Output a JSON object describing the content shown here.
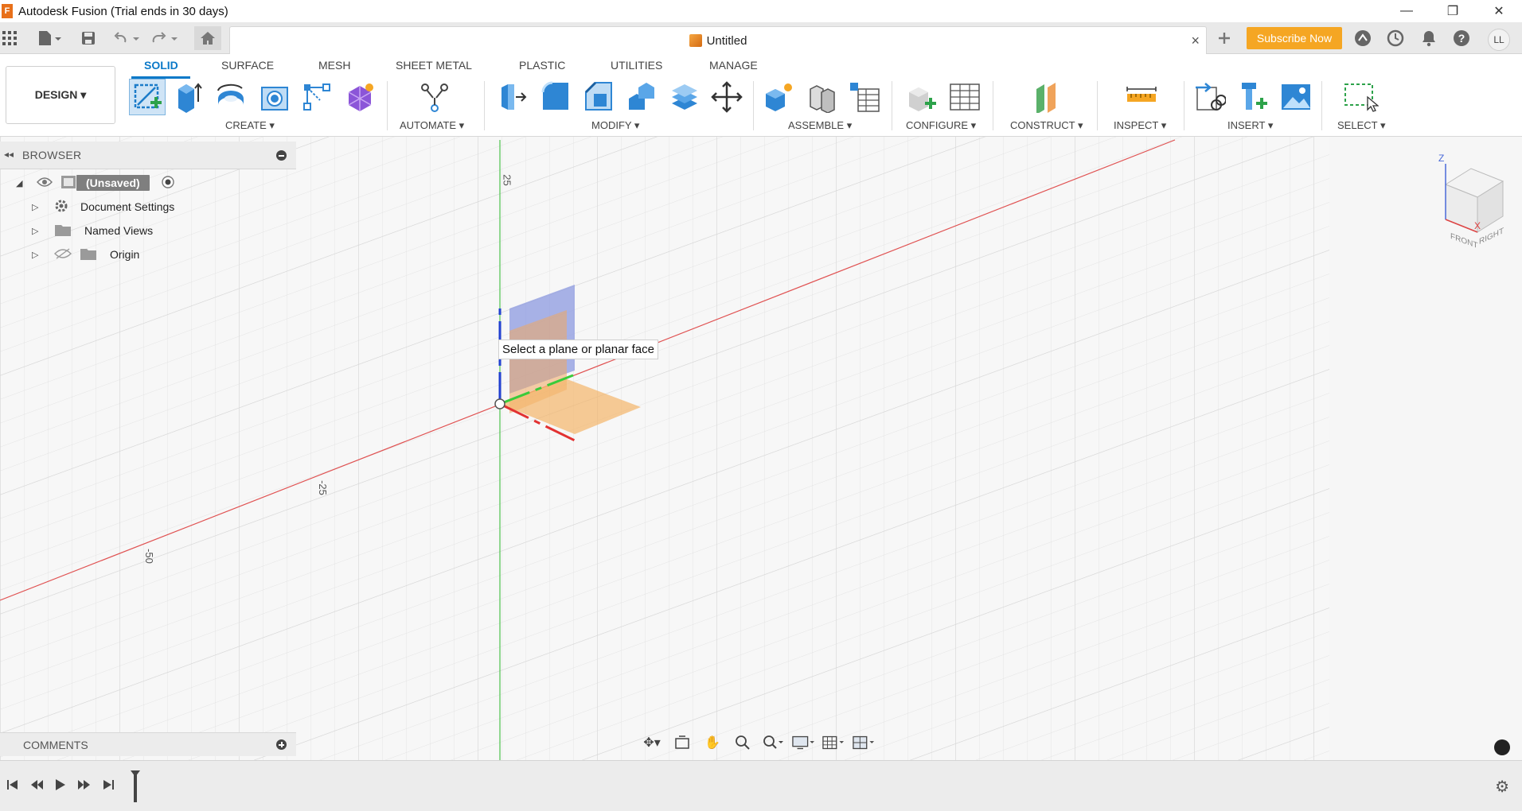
{
  "window": {
    "app_icon_letter": "F",
    "title": "Autodesk Fusion (Trial ends in 30 days)",
    "minimize_glyph": "—",
    "restore_glyph": "❐",
    "close_glyph": "✕"
  },
  "document": {
    "tab_title": "Untitled",
    "tab_close_glyph": "×"
  },
  "header": {
    "subscribe_label": "Subscribe Now",
    "avatar_initials": "LL",
    "icons": [
      "grid-menu-icon",
      "file-icon",
      "save-icon",
      "undo-icon",
      "redo-icon",
      "home-icon",
      "new-tab-plus-icon",
      "extensions-icon",
      "job-status-icon",
      "notifications-icon",
      "help-icon"
    ]
  },
  "ribbon": {
    "workspace_label": "DESIGN ▾",
    "tabs": [
      "SOLID",
      "SURFACE",
      "MESH",
      "SHEET METAL",
      "PLASTIC",
      "UTILITIES",
      "MANAGE"
    ],
    "active_tab": "SOLID",
    "groups": {
      "create": "CREATE ▾",
      "automate": "AUTOMATE ▾",
      "modify": "MODIFY ▾",
      "assemble": "ASSEMBLE ▾",
      "configure": "CONFIGURE ▾",
      "construct": "CONSTRUCT ▾",
      "inspect": "INSPECT ▾",
      "insert": "INSERT ▾",
      "select": "SELECT ▾"
    },
    "accent": "#0b79c8"
  },
  "browser": {
    "title": "BROWSER",
    "items": [
      {
        "label": "(Unsaved)",
        "icon": "component-icon"
      },
      {
        "label": "Document Settings",
        "icon": "gear-icon"
      },
      {
        "label": "Named Views",
        "icon": "folder-icon"
      },
      {
        "label": "Origin",
        "icon": "folder-icon"
      }
    ]
  },
  "viewport": {
    "tooltip": "Select a plane or planar face",
    "tick_labels": [
      "25",
      "-25",
      "-50"
    ],
    "viewcube_faces": [
      "FRONT",
      "RIGHT"
    ],
    "viewcube_axes": [
      "Z",
      "X"
    ]
  },
  "comments": {
    "title": "COMMENTS"
  },
  "timeline": {
    "buttons": [
      "first-icon",
      "previous-icon",
      "play-icon",
      "next-icon",
      "last-icon"
    ]
  }
}
